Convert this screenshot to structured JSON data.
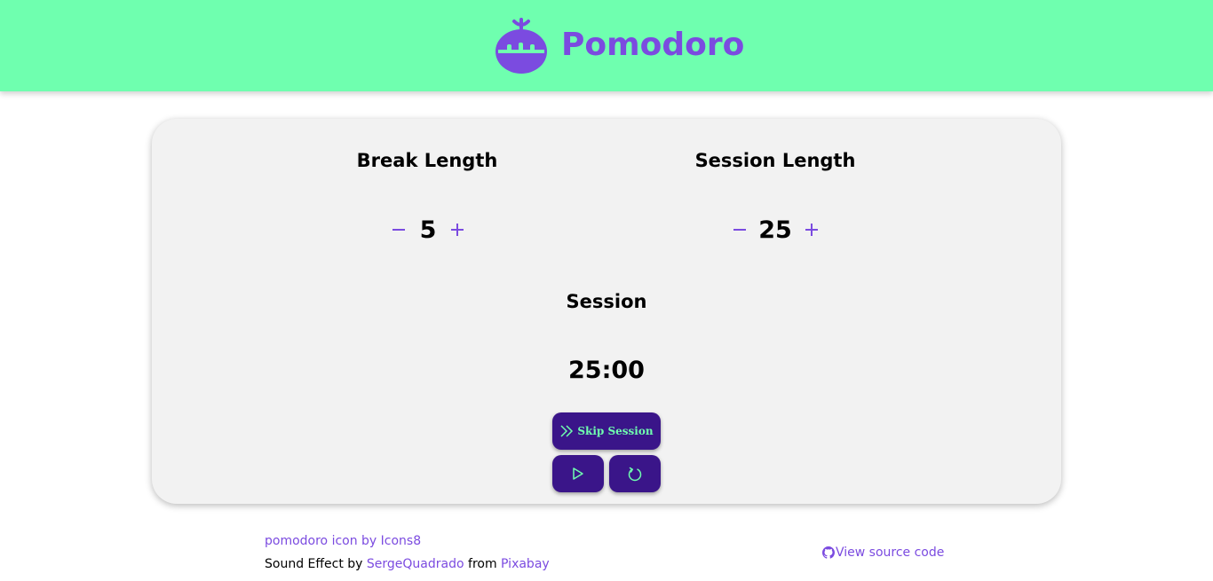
{
  "header": {
    "title": "Pomodoro",
    "logo_icon": "tomato-icon",
    "background_color": "#6fffaf",
    "accent_color": "#7b4be0"
  },
  "break_length": {
    "label": "Break Length",
    "value": "5",
    "decrement_icon": "minus-icon",
    "increment_icon": "plus-icon"
  },
  "session_length": {
    "label": "Session Length",
    "value": "25",
    "decrement_icon": "minus-icon",
    "increment_icon": "plus-icon"
  },
  "timer": {
    "label": "Session",
    "time": "25:00"
  },
  "controls": {
    "skip_label": "Skip Session",
    "skip_icon": "double-chevron-right-icon",
    "play_icon": "play-icon",
    "reset_icon": "refresh-icon",
    "button_color": "#3a1589",
    "button_text_color": "#6fffaf"
  },
  "footer": {
    "icon_credit": "pomodoro icon by Icons8",
    "sound_prefix": "Sound Effect by ",
    "sound_author": "SergeQuadrado",
    "sound_middle": " from ",
    "sound_source": "Pixabay",
    "source_code_label": "View source code",
    "source_code_icon": "github-icon"
  }
}
